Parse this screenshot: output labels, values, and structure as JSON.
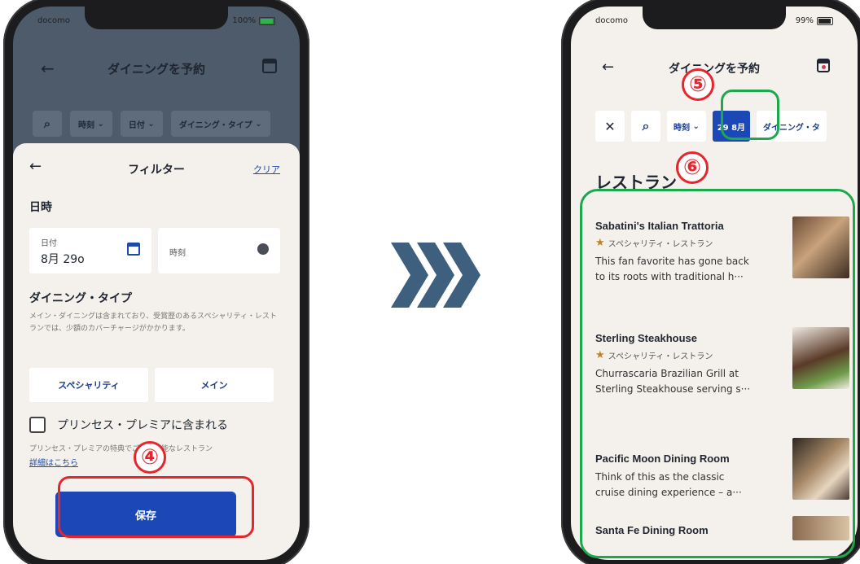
{
  "colors": {
    "accent": "#1b48b6",
    "highlight_red": "#e5262d",
    "highlight_green": "#1da84c",
    "arrow": "#3f5f7e"
  },
  "left_phone": {
    "status": {
      "carrier": "docomo",
      "battery": "100%"
    },
    "header": {
      "title": "ダイニングを予約"
    },
    "chips": [
      "時刻",
      "日付",
      "ダイニング・タイプ"
    ],
    "filter": {
      "title": "フィルター",
      "clear_label": "クリア",
      "datetime_section": "日時",
      "date_label": "日付",
      "date_value": "8月 29o",
      "time_label": "時刻",
      "dining_type_section": "ダイニング・タイプ",
      "dining_type_desc": "メイン・ダイニングは含まれており、受賞歴のあるスペシャリティ・レストランでは、少額のカバーチャージがかかります。",
      "type_options": [
        "スペシャリティ",
        "メイン"
      ],
      "premier_label": "プリンセス・プレミアに含まれる",
      "premier_note": "プリンセス・プレミアの特典でご利用可能なレストラン",
      "details_link": "詳細はこちら",
      "save_label": "保存"
    },
    "step_number": "④"
  },
  "right_phone": {
    "status": {
      "carrier": "docomo",
      "battery": "99%"
    },
    "header": {
      "title": "ダイニングを予約"
    },
    "chips": {
      "time": "時刻",
      "date": "29 8月",
      "dining_type": "ダイニング・タ"
    },
    "section_title": "レストラン",
    "restaurants": [
      {
        "name": "Sabatini's Italian Trattoria",
        "category": "スペシャリティ・レストラン",
        "desc_line1": "This fan favorite has gone back",
        "desc_line2": "to its roots with traditional h···"
      },
      {
        "name": "Sterling Steakhouse",
        "category": "スペシャリティ・レストラン",
        "desc_line1": "Churrascaria Brazilian Grill at",
        "desc_line2": "Sterling Steakhouse serving s···"
      },
      {
        "name": "Pacific Moon Dining Room",
        "category": "",
        "desc_line1": "Think of this as the classic",
        "desc_line2": "cruise dining experience – a···"
      },
      {
        "name": "Santa Fe Dining Room",
        "category": "",
        "desc_line1": "",
        "desc_line2": ""
      }
    ],
    "step_numbers": [
      "⑤",
      "⑥"
    ]
  }
}
